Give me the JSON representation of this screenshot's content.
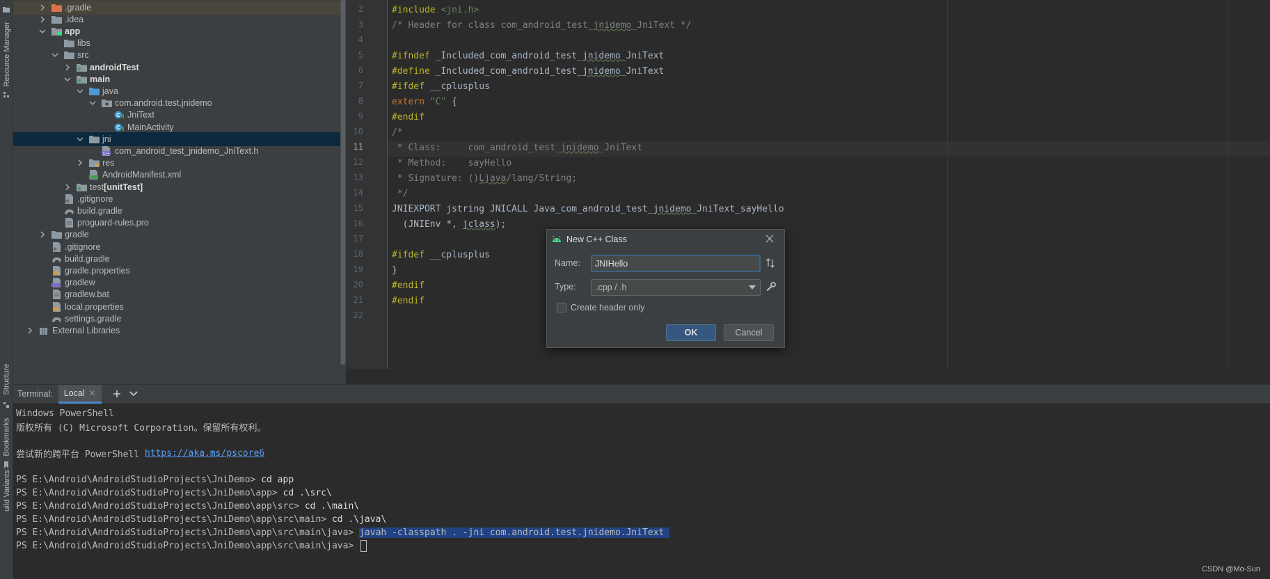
{
  "left_strip": {
    "resource_manager": "Resource Manager",
    "structure": "Structure",
    "bookmarks": "Bookmarks",
    "variants": "uild Variants"
  },
  "project_tree": [
    {
      "label": ".gradle",
      "depth": 1,
      "arrow": "right",
      "icon": "folder-orange",
      "bold": false
    },
    {
      "label": ".idea",
      "depth": 1,
      "arrow": "right",
      "icon": "folder",
      "bold": false
    },
    {
      "label": "app",
      "depth": 1,
      "arrow": "down",
      "icon": "folder-module",
      "bold": true
    },
    {
      "label": "libs",
      "depth": 2,
      "arrow": "none",
      "icon": "folder",
      "bold": false
    },
    {
      "label": "src",
      "depth": 2,
      "arrow": "down",
      "icon": "folder",
      "bold": false
    },
    {
      "label": "androidTest",
      "depth": 3,
      "arrow": "right",
      "icon": "folder-test",
      "bold": true
    },
    {
      "label": "main",
      "depth": 3,
      "arrow": "down",
      "icon": "folder-test",
      "bold": true
    },
    {
      "label": "java",
      "depth": 4,
      "arrow": "down",
      "icon": "folder-blue",
      "bold": false
    },
    {
      "label": "com.android.test.jnidemo",
      "depth": 5,
      "arrow": "down",
      "icon": "package",
      "bold": false
    },
    {
      "label": "JniText",
      "depth": 6,
      "arrow": "none",
      "icon": "class",
      "bold": false
    },
    {
      "label": "MainActivity",
      "depth": 6,
      "arrow": "none",
      "icon": "class",
      "bold": false
    },
    {
      "label": "jni",
      "depth": 4,
      "arrow": "down",
      "icon": "folder",
      "bold": false
    },
    {
      "label": "com_android_test_jnidemo_JniText.h",
      "depth": 5,
      "arrow": "none",
      "icon": "header",
      "bold": false
    },
    {
      "label": "res",
      "depth": 4,
      "arrow": "right",
      "icon": "folder-res",
      "bold": false
    },
    {
      "label": "AndroidManifest.xml",
      "depth": 4,
      "arrow": "none",
      "icon": "manifest",
      "bold": false
    },
    {
      "label": "test",
      "suffix": "[unitTest]",
      "depth": 3,
      "arrow": "right",
      "icon": "folder-test",
      "bold": false
    },
    {
      "label": ".gitignore",
      "depth": 2,
      "arrow": "none",
      "icon": "gitignore",
      "bold": false
    },
    {
      "label": "build.gradle",
      "depth": 2,
      "arrow": "none",
      "icon": "gradle",
      "bold": false
    },
    {
      "label": "proguard-rules.pro",
      "depth": 2,
      "arrow": "none",
      "icon": "file",
      "bold": false
    },
    {
      "label": "gradle",
      "depth": 1,
      "arrow": "right",
      "icon": "folder",
      "bold": false
    },
    {
      "label": ".gitignore",
      "depth": 1,
      "arrow": "none",
      "icon": "gitignore",
      "bold": false
    },
    {
      "label": "build.gradle",
      "depth": 1,
      "arrow": "none",
      "icon": "gradle",
      "bold": false
    },
    {
      "label": "gradle.properties",
      "depth": 1,
      "arrow": "none",
      "icon": "properties",
      "bold": false
    },
    {
      "label": "gradlew",
      "depth": 1,
      "arrow": "none",
      "icon": "script",
      "bold": false
    },
    {
      "label": "gradlew.bat",
      "depth": 1,
      "arrow": "none",
      "icon": "file",
      "bold": false
    },
    {
      "label": "local.properties",
      "depth": 1,
      "arrow": "none",
      "icon": "properties",
      "bold": false
    },
    {
      "label": "settings.gradle",
      "depth": 1,
      "arrow": "none",
      "icon": "gradle",
      "bold": false
    },
    {
      "label": "External Libraries",
      "depth": 0,
      "arrow": "right",
      "icon": "library",
      "bold": false
    }
  ],
  "editor": {
    "current_line": 11,
    "lines": [
      {
        "n": "2",
        "segs": [
          [
            "pp",
            "#include "
          ],
          [
            "ang",
            "<jni.h>"
          ]
        ]
      },
      {
        "n": "3",
        "segs": [
          [
            "cmt",
            "/* Header for class com_android_test_"
          ],
          [
            "cmtw",
            "jnidemo"
          ],
          [
            "cmt",
            "_JniText */"
          ]
        ]
      },
      {
        "n": "4",
        "segs": []
      },
      {
        "n": "5",
        "segs": [
          [
            "pp",
            "#ifndef "
          ],
          [
            "t",
            "_Included_com_android_test_"
          ],
          [
            "tw",
            "jnidemo"
          ],
          [
            "t",
            "_JniText"
          ]
        ]
      },
      {
        "n": "6",
        "segs": [
          [
            "pp",
            "#define "
          ],
          [
            "t",
            "_Included_com_android_test_"
          ],
          [
            "tw",
            "jnidemo"
          ],
          [
            "t",
            "_JniText"
          ]
        ]
      },
      {
        "n": "7",
        "segs": [
          [
            "pp",
            "#ifdef "
          ],
          [
            "t",
            "__cplusplus"
          ]
        ]
      },
      {
        "n": "8",
        "segs": [
          [
            "kw",
            "extern "
          ],
          [
            "str",
            "\"C\""
          ],
          [
            "t",
            " {"
          ]
        ]
      },
      {
        "n": "9",
        "segs": [
          [
            "pp",
            "#endif"
          ]
        ]
      },
      {
        "n": "10",
        "segs": [
          [
            "cmt",
            "/*"
          ]
        ]
      },
      {
        "n": "11",
        "segs": [
          [
            "cmt",
            " * Class:     com_android_test_"
          ],
          [
            "cmtw",
            "jnidemo"
          ],
          [
            "cmt",
            "_JniText"
          ]
        ]
      },
      {
        "n": "12",
        "segs": [
          [
            "cmt",
            " * Method:    sayHello"
          ]
        ]
      },
      {
        "n": "13",
        "segs": [
          [
            "cmt",
            " * Signature: ()"
          ],
          [
            "cmtw",
            "Ljava"
          ],
          [
            "cmt",
            "/lang/String;"
          ]
        ]
      },
      {
        "n": "14",
        "segs": [
          [
            "cmt",
            " */"
          ]
        ]
      },
      {
        "n": "15",
        "segs": [
          [
            "t",
            "JNIEXPORT jstring JNICALL Java_com_android_test_"
          ],
          [
            "tw",
            "jnidemo"
          ],
          [
            "t",
            "_JniText_sayHello"
          ]
        ]
      },
      {
        "n": "16",
        "segs": [
          [
            "t",
            "  (JNIEnv *, "
          ],
          [
            "tw",
            "jclass"
          ],
          [
            "t",
            ");"
          ]
        ]
      },
      {
        "n": "17",
        "segs": []
      },
      {
        "n": "18",
        "segs": [
          [
            "pp",
            "#ifdef "
          ],
          [
            "t",
            "__cplusplus"
          ]
        ]
      },
      {
        "n": "19",
        "segs": [
          [
            "t",
            "}"
          ]
        ]
      },
      {
        "n": "20",
        "segs": [
          [
            "pp",
            "#endif"
          ]
        ]
      },
      {
        "n": "21",
        "segs": [
          [
            "pp",
            "#endif"
          ]
        ]
      },
      {
        "n": "22",
        "segs": []
      }
    ]
  },
  "dialog": {
    "title": "New C++ Class",
    "name_label": "Name:",
    "name_value": "JNIHello",
    "type_label": "Type:",
    "type_value": ".cpp / .h",
    "header_only_label": "Create header only",
    "ok_label": "OK",
    "cancel_label": "Cancel"
  },
  "terminal": {
    "title": "Terminal:",
    "tab_label": "Local",
    "lines": [
      {
        "text": "Windows PowerShell"
      },
      {
        "text": "版权所有 (C) Microsoft Corporation。保留所有权利。"
      },
      {
        "text": ""
      },
      {
        "text": "尝试新的跨平台 PowerShell ",
        "link": "https://aka.ms/pscore6"
      },
      {
        "text": ""
      },
      {
        "text": "PS E:\\Android\\AndroidStudioProjects\\JniDemo> ",
        "cmd": "cd app"
      },
      {
        "text": "PS E:\\Android\\AndroidStudioProjects\\JniDemo\\app> ",
        "cmd": "cd .\\src\\"
      },
      {
        "text": "PS E:\\Android\\AndroidStudioProjects\\JniDemo\\app\\src> ",
        "cmd": "cd .\\main\\"
      },
      {
        "text": "PS E:\\Android\\AndroidStudioProjects\\JniDemo\\app\\src\\main> ",
        "cmd": "cd .\\java\\"
      },
      {
        "text": "PS E:\\Android\\AndroidStudioProjects\\JniDemo\\app\\src\\main\\java> ",
        "selected": "javah -classpath . -jni com.android.test.jnidemo.JniText "
      },
      {
        "text": "PS E:\\Android\\AndroidStudioProjects\\JniDemo\\app\\src\\main\\java> ",
        "caret": true
      }
    ]
  },
  "watermark": "CSDN @Mo-Sun"
}
